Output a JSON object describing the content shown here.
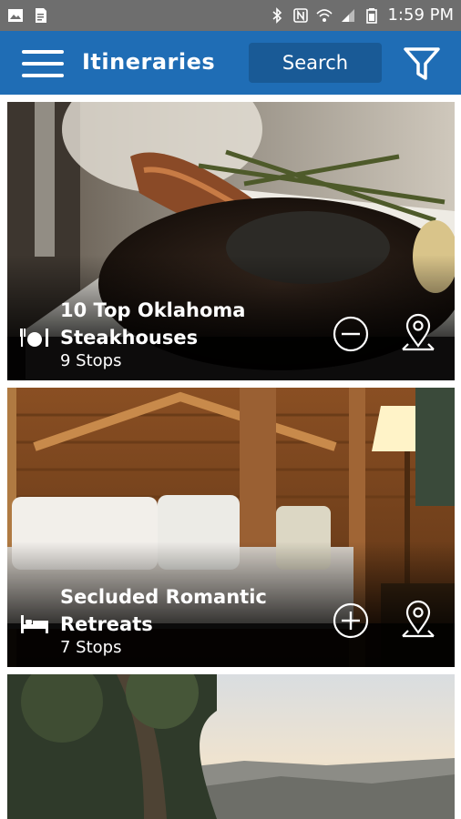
{
  "status_bar": {
    "time": "1:59 PM"
  },
  "app_bar": {
    "title": "Itineraries",
    "search_label": "Search"
  },
  "cards": [
    {
      "title_line1": "10 Top Oklahoma",
      "title_line2": "Steakhouses",
      "stops": "9 Stops",
      "category_icon": "dining-icon",
      "action_icon": "remove-circle-icon"
    },
    {
      "title_line1": "Secluded Romantic",
      "title_line2": "Retreats",
      "stops": "7 Stops",
      "category_icon": "lodging-icon",
      "action_icon": "add-circle-icon"
    }
  ],
  "colors": {
    "app_bar": "#1f6db5",
    "search_button": "#195a96",
    "status_bar": "#6e6e6e"
  }
}
